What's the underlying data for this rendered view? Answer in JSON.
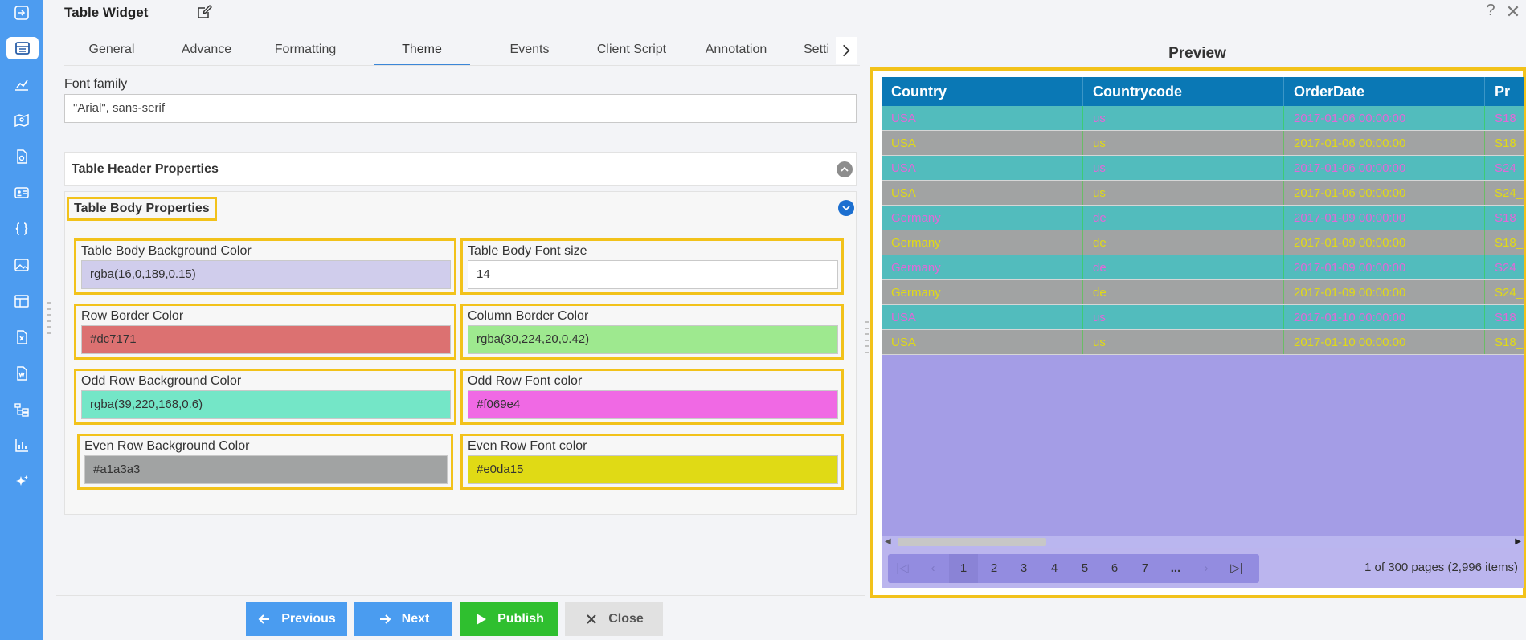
{
  "app": {
    "title": "Table Widget",
    "help": "?",
    "close": "✕"
  },
  "rail": {
    "icons": [
      "arrow-right-to-line-icon",
      "table-widget-icon",
      "chart-icon",
      "map-icon",
      "document-icon",
      "id-card-icon",
      "braces-icon",
      "image-icon",
      "layout-icon",
      "excel-icon",
      "word-icon",
      "hierarchy-icon",
      "bar-chart-icon",
      "sparkle-icon"
    ]
  },
  "tabs": [
    {
      "label": "General"
    },
    {
      "label": "Advance"
    },
    {
      "label": "Formatting"
    },
    {
      "label": "Theme"
    },
    {
      "label": "Events"
    },
    {
      "label": "Client Script"
    },
    {
      "label": "Annotation"
    },
    {
      "label": "Setti"
    }
  ],
  "active_tab": "Theme",
  "font_family": {
    "label": "Font family",
    "value": "\"Arial\", sans-serif"
  },
  "header_section": {
    "title": "Table Header Properties"
  },
  "body_section": {
    "title": "Table Body Properties",
    "fields": {
      "bg_color": {
        "label": "Table Body Background Color",
        "value": "rgba(16,0,189,0.15)",
        "swatch": "#d0cdec"
      },
      "font_size": {
        "label": "Table Body Font size",
        "value": "14",
        "swatch": "#ffffff"
      },
      "row_border": {
        "label": "Row Border Color",
        "value": "#dc7171",
        "swatch": "#dc7171"
      },
      "col_border": {
        "label": "Column Border Color",
        "value": "rgba(30,224,20,0.42)",
        "swatch": "#9ee98f"
      },
      "odd_bg": {
        "label": "Odd Row Background Color",
        "value": "rgba(39,220,168,0.6)",
        "swatch": "#74e6c7"
      },
      "odd_font": {
        "label": "Odd Row Font color",
        "value": "#f069e4",
        "swatch": "#f069e4"
      },
      "even_bg": {
        "label": "Even Row Background Color",
        "value": "#a1a3a3",
        "swatch": "#a1a3a3"
      },
      "even_font": {
        "label": "Even Row Font color",
        "value": "#e0da15",
        "swatch": "#e0da15"
      }
    }
  },
  "buttons": {
    "previous": "Previous",
    "next": "Next",
    "publish": "Publish",
    "close": "Close"
  },
  "preview": {
    "title": "Preview",
    "columns": [
      "Country",
      "Countrycode",
      "OrderDate",
      "Pr"
    ],
    "rows": [
      [
        "USA",
        "us",
        "2017-01-06 00:00:00",
        "S18"
      ],
      [
        "USA",
        "us",
        "2017-01-06 00:00:00",
        "S18_"
      ],
      [
        "USA",
        "us",
        "2017-01-06 00:00:00",
        "S24"
      ],
      [
        "USA",
        "us",
        "2017-01-06 00:00:00",
        "S24_"
      ],
      [
        "Germany",
        "de",
        "2017-01-09 00:00:00",
        "S18"
      ],
      [
        "Germany",
        "de",
        "2017-01-09 00:00:00",
        "S18_"
      ],
      [
        "Germany",
        "de",
        "2017-01-09 00:00:00",
        "S24"
      ],
      [
        "Germany",
        "de",
        "2017-01-09 00:00:00",
        "S24_"
      ],
      [
        "USA",
        "us",
        "2017-01-10 00:00:00",
        "S18"
      ],
      [
        "USA",
        "us",
        "2017-01-10 00:00:00",
        "S18_"
      ]
    ],
    "pager": {
      "pages": [
        "1",
        "2",
        "3",
        "4",
        "5",
        "6",
        "7",
        "..."
      ],
      "current": "1",
      "info": "1 of 300 pages (2,996 items)"
    }
  }
}
